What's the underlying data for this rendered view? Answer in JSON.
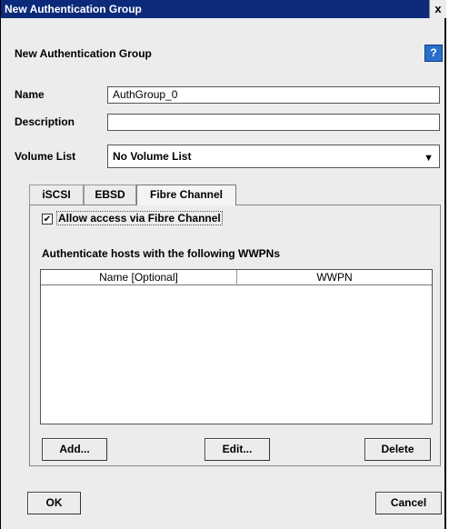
{
  "window": {
    "title": "New Authentication Group",
    "close_label": "x"
  },
  "header": {
    "title": "New Authentication Group",
    "help_label": "?"
  },
  "form": {
    "name_label": "Name",
    "name_value": "AuthGroup_0",
    "description_label": "Description",
    "description_value": "",
    "volume_list_label": "Volume List",
    "volume_list_value": "No Volume List"
  },
  "tabs": [
    {
      "label": "iSCSI"
    },
    {
      "label": "EBSD"
    },
    {
      "label": "Fibre Channel",
      "active": true
    }
  ],
  "fibre_channel": {
    "checkbox_label": "Allow access via Fibre Channel",
    "checkbox_mark": "✔",
    "section_label": "Authenticate hosts with the following WWPNs",
    "columns": [
      "Name [Optional]",
      "WWPN"
    ],
    "rows": [],
    "add_label": "Add...",
    "edit_label": "Edit...",
    "delete_label": "Delete"
  },
  "footer": {
    "ok_label": "OK",
    "cancel_label": "Cancel"
  }
}
